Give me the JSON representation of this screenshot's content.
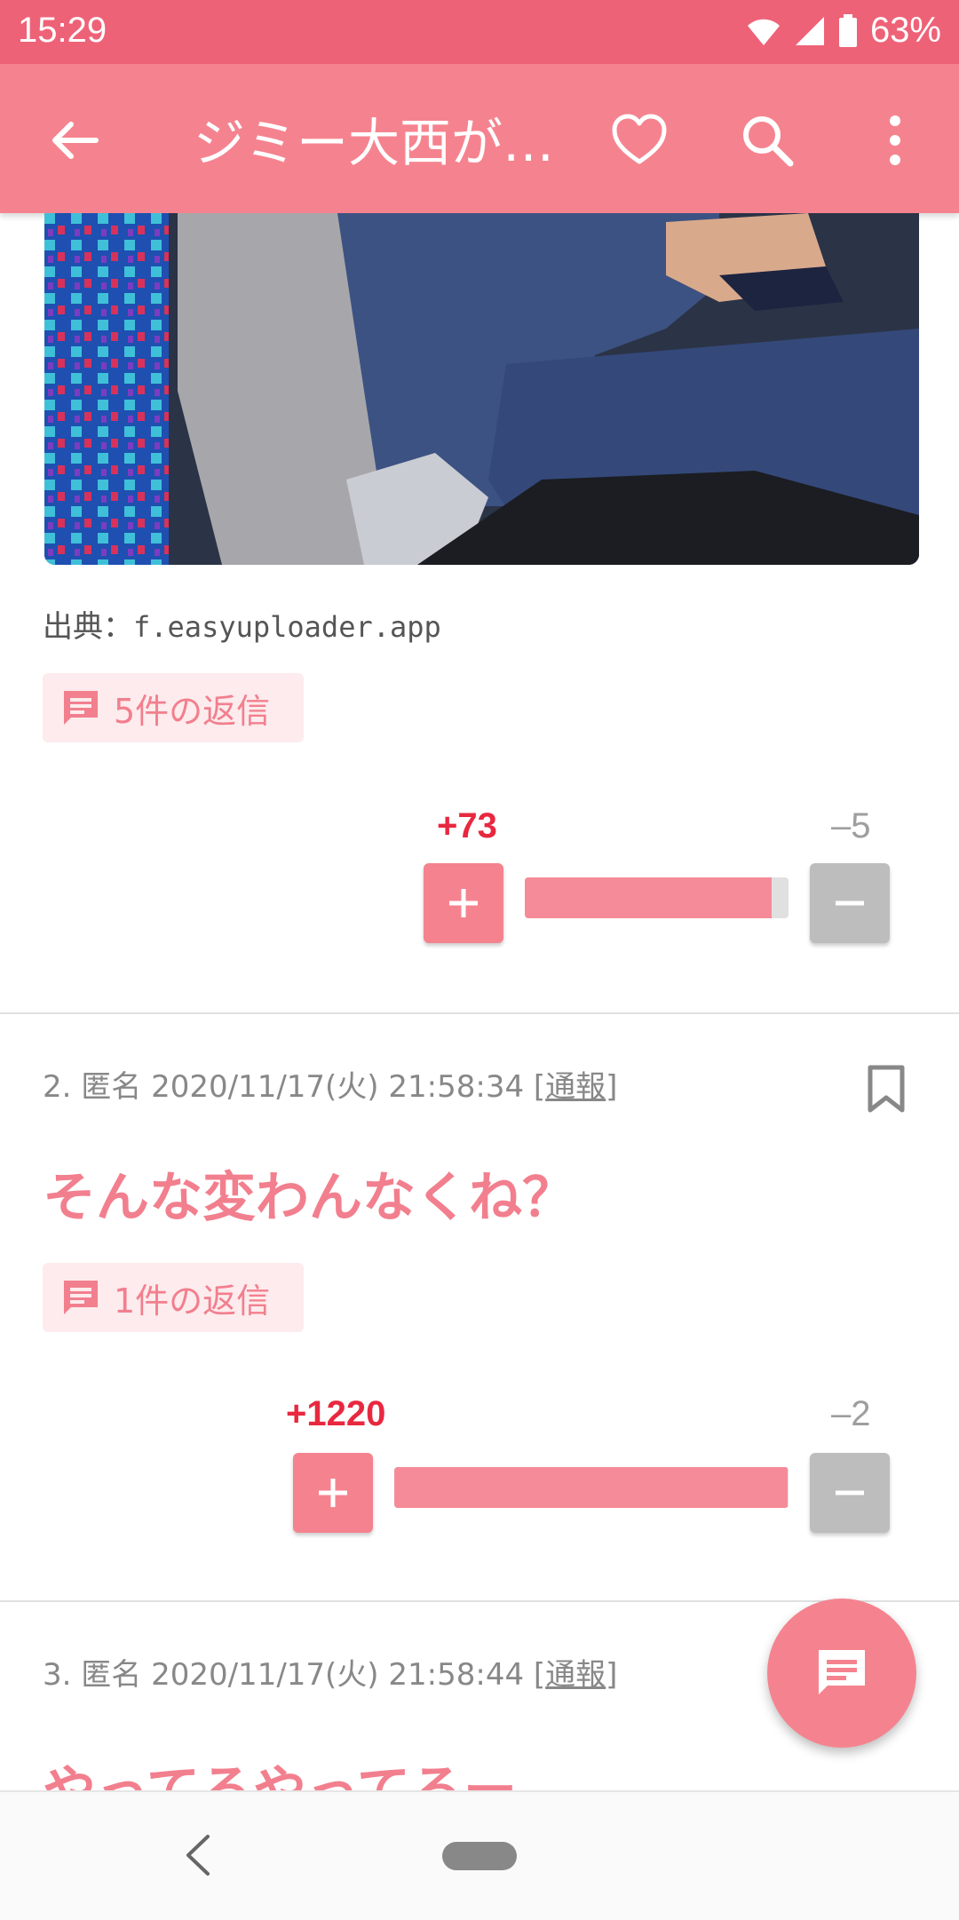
{
  "status_bar": {
    "time": "15:29",
    "battery": "63%"
  },
  "app_bar": {
    "title": "ジミー大西が…"
  },
  "post1": {
    "source_label": "出典：",
    "source_domain": "f.easyuploader.app",
    "replies_label": "5件の返信",
    "plus_count": "+73",
    "minus_count": "–5",
    "plus_ratio": 0.936
  },
  "post2": {
    "number": "2.",
    "author": "匿名",
    "datetime": "2020/11/17(火) 21:58:34",
    "report_open": "[",
    "report_label": "通報",
    "report_close": "]",
    "title": "そんな変わんなくね？",
    "replies_label": "1件の返信",
    "plus_count": "+1220",
    "minus_count": "–2",
    "plus_ratio": 0.998
  },
  "post3": {
    "number": "3.",
    "author": "匿名",
    "datetime": "2020/11/17(火) 21:58:44",
    "report_open": "[",
    "report_label": "通報",
    "report_close": "]",
    "title": "やってるやってるー"
  },
  "colors": {
    "accent": "#f5838f",
    "status_bar": "#ee6277",
    "plus_red": "#e8283f",
    "minus_gray": "#bdbdbd"
  }
}
